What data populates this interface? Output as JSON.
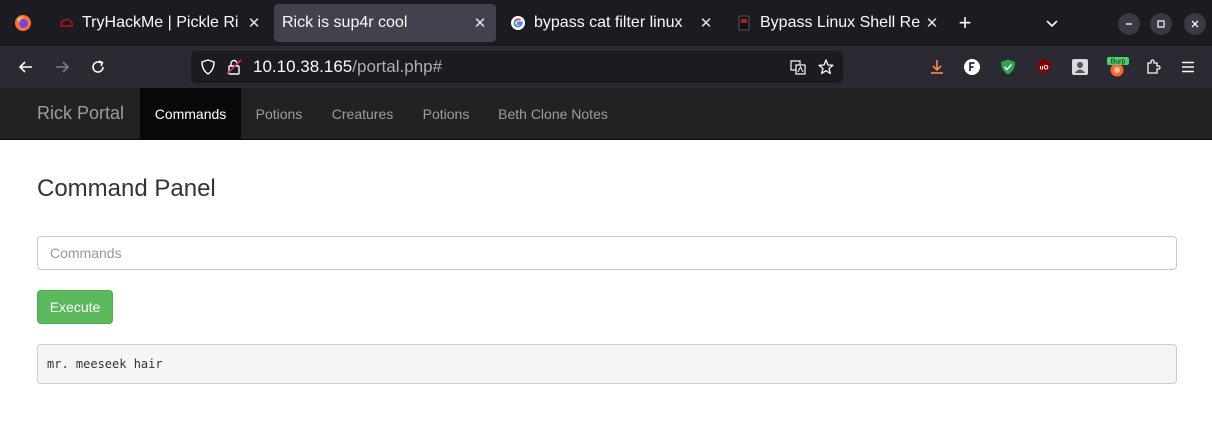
{
  "browser": {
    "tabs": [
      {
        "title": "TryHackMe | Pickle Ri",
        "favicon": "tryhackme-icon",
        "active": false
      },
      {
        "title": "Rick is sup4r cool",
        "favicon": "none",
        "active": true
      },
      {
        "title": "bypass cat filter linux",
        "favicon": "google-icon",
        "active": false
      },
      {
        "title": "Bypass Linux Shell Re",
        "favicon": "page-icon",
        "active": false
      }
    ],
    "new_tab_label": "+",
    "close_label": "✕",
    "url": {
      "host": "10.10.38.165",
      "path": "/portal.php#"
    },
    "extensions": [
      "download-icon",
      "f-extension-icon",
      "shield-extension-icon",
      "ublock-icon",
      "user-extension-icon",
      "burp-icon",
      "extensions-icon",
      "menu-icon"
    ],
    "burp_label": "Burp"
  },
  "site": {
    "brand": "Rick Portal",
    "nav": [
      {
        "label": "Commands",
        "active": true
      },
      {
        "label": "Potions",
        "active": false
      },
      {
        "label": "Creatures",
        "active": false
      },
      {
        "label": "Potions",
        "active": false
      },
      {
        "label": "Beth Clone Notes",
        "active": false
      }
    ]
  },
  "panel": {
    "title": "Command Panel",
    "input_placeholder": "Commands",
    "input_value": "",
    "execute_label": "Execute",
    "output": "mr. meeseek hair"
  },
  "colors": {
    "tab_bar": "#1c1b22",
    "toolbar": "#2b2a33",
    "site_nav": "#222222",
    "execute": "#5cb85c"
  }
}
